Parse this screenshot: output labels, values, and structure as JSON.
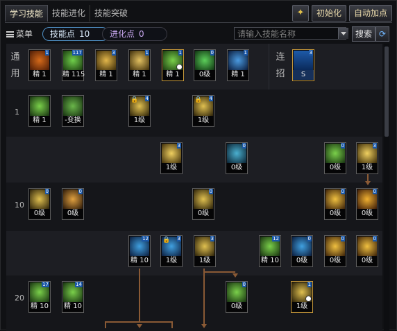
{
  "tabs": [
    {
      "label": "学习技能",
      "active": true
    },
    {
      "label": "技能进化",
      "active": false
    },
    {
      "label": "技能突破",
      "active": false
    }
  ],
  "top_buttons": {
    "star_icon": "star-icon",
    "reset_label": "初始化",
    "auto_label": "自动加点"
  },
  "toolbar": {
    "menu_label": "菜单",
    "skill_points_label": "技能点",
    "skill_points_value": "10",
    "evo_points_label": "进化点",
    "evo_points_value": "0",
    "search_placeholder": "请输入技能名称",
    "search_button": "搜索",
    "refresh_icon": "refresh-icon"
  },
  "general_label": [
    "通",
    "用"
  ],
  "combo_label": [
    "连",
    "招"
  ],
  "row_labels": {
    "r1": "1",
    "r10": "10",
    "r20": "20"
  },
  "colors": {
    "accent": "#4f8fc4",
    "line": "#8a5a35",
    "gold_border": "#c89a3a"
  },
  "skills": {
    "g1": {
      "lvl": "精 1",
      "badge": "1"
    },
    "g2": {
      "lvl": "精 115",
      "badge": "117"
    },
    "g3": {
      "lvl": "精 1",
      "badge": "3"
    },
    "g4": {
      "lvl": "精 1",
      "badge": "1"
    },
    "g5": {
      "lvl": "精 1",
      "badge": "1"
    },
    "g6": {
      "lvl": "0级",
      "badge": "0"
    },
    "g7": {
      "lvl": "精 1",
      "badge": "1"
    },
    "combo": {
      "lvl": "S",
      "badge": "3"
    },
    "r1a": {
      "lvl": "精 1",
      "badge": ""
    },
    "r1b": {
      "lvl": "-变换",
      "badge": ""
    },
    "r1c": {
      "lvl": "1级",
      "badge": "4"
    },
    "r1d": {
      "lvl": "1级",
      "badge": "4"
    },
    "r2a": {
      "lvl": "1级",
      "badge": "3"
    },
    "r2b": {
      "lvl": "0级",
      "badge": "0"
    },
    "r2c": {
      "lvl": "0级",
      "badge": "0"
    },
    "r2d": {
      "lvl": "1级",
      "badge": "3"
    },
    "r10a": {
      "lvl": "0级",
      "badge": "0"
    },
    "r10b": {
      "lvl": "0级",
      "badge": "0"
    },
    "r10c": {
      "lvl": "0级",
      "badge": "0"
    },
    "r10d": {
      "lvl": "0级",
      "badge": "0"
    },
    "r10e": {
      "lvl": "0级",
      "badge": "0"
    },
    "r4a": {
      "lvl": "精 10",
      "badge": "12"
    },
    "r4b": {
      "lvl": "1级",
      "badge": "3"
    },
    "r4c": {
      "lvl": "1级",
      "badge": "3"
    },
    "r4d": {
      "lvl": "精 10",
      "badge": "12"
    },
    "r4e": {
      "lvl": "0级",
      "badge": "0"
    },
    "r4f": {
      "lvl": "0级",
      "badge": "0"
    },
    "r4g": {
      "lvl": "0级",
      "badge": "0"
    },
    "r20a": {
      "lvl": "精 10",
      "badge": "17"
    },
    "r20b": {
      "lvl": "精 10",
      "badge": "14"
    },
    "r20c": {
      "lvl": "0级",
      "badge": "0"
    },
    "r20d": {
      "lvl": "1级",
      "badge": "1"
    }
  }
}
